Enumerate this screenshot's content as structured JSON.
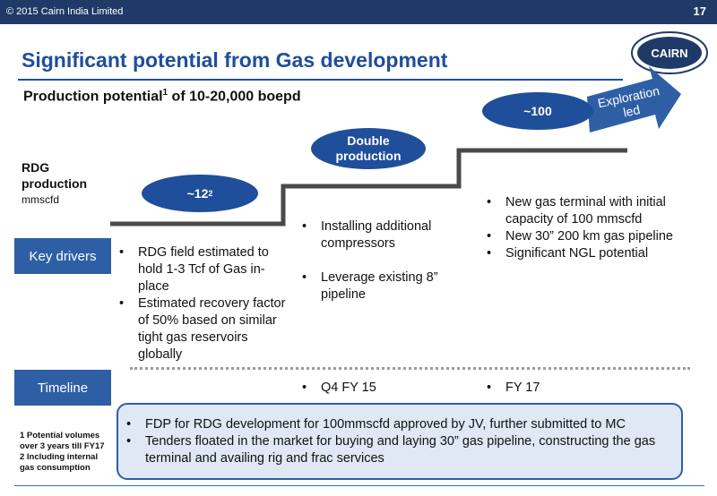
{
  "header": {
    "copyright": "© 2015 Cairn India Limited",
    "page_number": "17"
  },
  "logo": {
    "text": "CAIRN"
  },
  "title": "Significant potential from Gas development",
  "subtitle": {
    "pre": "Production potential",
    "sup": "1",
    "post": " of 10-20,000 boepd"
  },
  "rdg": {
    "line1": "RDG",
    "line2": "production",
    "unit": "mmscfd"
  },
  "stages": {
    "stage1": {
      "base": "~12",
      "sup": "2"
    },
    "stage2": {
      "line1": "Double",
      "line2": "production"
    },
    "stage3": "~100",
    "arrow": {
      "line1": "Exploration",
      "line2": "led"
    }
  },
  "labels": {
    "key_drivers": "Key drivers",
    "timeline": "Timeline"
  },
  "drivers": {
    "col1": [
      "RDG field estimated to hold 1-3 Tcf of Gas in-place",
      "Estimated recovery factor of 50% based on similar tight gas reservoirs globally"
    ],
    "col2": [
      "Installing additional compressors",
      "Leverage existing 8” pipeline"
    ],
    "col3": [
      "New gas terminal with initial capacity of 100 mmscfd",
      "New 30” 200 km gas pipeline",
      "Significant NGL potential"
    ]
  },
  "timeline": {
    "col2": "Q4 FY 15",
    "col3": "FY 17"
  },
  "footnotes": {
    "note1": "1 Potential volumes over 3 years till FY17",
    "note2": "2 Including internal gas consumption"
  },
  "fdp": [
    "FDP for RDG development for 100mmscfd approved by JV, further submitted to MC",
    "Tenders floated in the market for buying and laying 30” gas pipeline, constructing the gas terminal and availing rig and frac services"
  ],
  "colors": {
    "header_bg": "#1f3a66",
    "accent": "#1f4e9a",
    "box_bg": "#2e5fa5",
    "step": "#4a4a4a"
  }
}
